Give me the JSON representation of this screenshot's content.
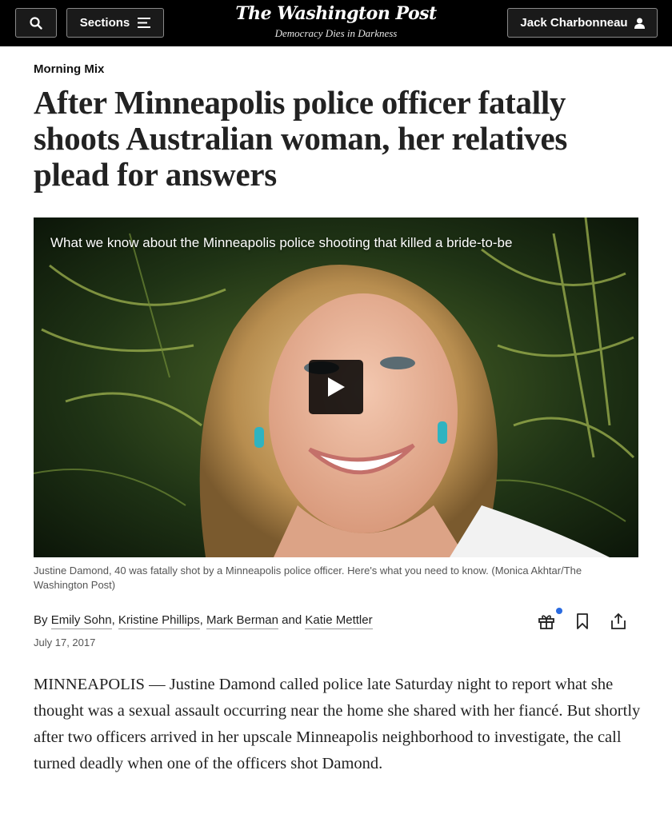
{
  "header": {
    "sections_label": "Sections",
    "logo": "The Washington Post",
    "tagline": "Democracy Dies in Darkness",
    "user_name": "Jack Charbonneau",
    "icons": [
      "search-icon",
      "menu-icon",
      "user-icon"
    ]
  },
  "article": {
    "kicker": "Morning Mix",
    "headline": "After Minneapolis police officer fatally shoots Australian woman, her relatives plead for answers",
    "video_title": "What we know about the Minneapolis police shooting that killed a bride-to-be",
    "caption": "Justine Damond, 40 was fatally shot by a Minneapolis police officer. Here's what you need to know. (Monica Akhtar/The Washington Post)",
    "byline": {
      "prefix": "By",
      "authors": [
        "Emily Sohn",
        "Kristine Phillips",
        "Mark Berman",
        "Katie Mettler"
      ],
      "sep1": ",",
      "sep2": ",",
      "and": "and"
    },
    "date": "July 17, 2017",
    "action_icons": [
      "gift-icon",
      "bookmark-icon",
      "share-icon"
    ],
    "body": "MINNEAPOLIS — Justine Damond called police late Saturday night to report what she thought was a sexual assault occurring near the home she shared with her fiancé. But shortly after two officers arrived in her upscale Minneapolis neighborhood to investigate, the call turned deadly when one of the officers shot Damond."
  },
  "colors": {
    "topbar": "#000000",
    "notification_dot": "#2a6be0",
    "text": "#222222",
    "caption": "#555555"
  }
}
